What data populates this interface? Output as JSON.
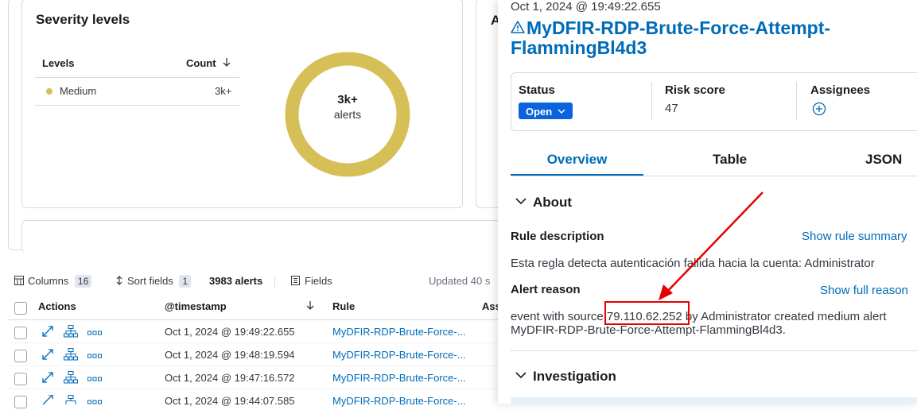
{
  "severity": {
    "title": "Severity levels",
    "col_levels": "Levels",
    "col_count": "Count",
    "rows": [
      {
        "level": "Medium",
        "count": "3k+",
        "color": "#d6bf57"
      }
    ],
    "donut_value": "3k+",
    "donut_label": "alerts",
    "donut_color": "#d6bf57"
  },
  "second_card_letter": "A",
  "toolbar": {
    "columns_label": "Columns",
    "columns_count": "16",
    "sort_label": "Sort fields",
    "sort_count": "1",
    "alerts_count": "3983 alerts",
    "fields_label": "Fields",
    "updated": "Updated 40 s"
  },
  "table": {
    "headers": {
      "actions": "Actions",
      "timestamp": "@timestamp",
      "rule": "Rule",
      "assignees": "Ass"
    },
    "rows": [
      {
        "timestamp": "Oct 1, 2024 @ 19:49:22.655",
        "rule": "MyDFIR-RDP-Brute-Force-..."
      },
      {
        "timestamp": "Oct 1, 2024 @ 19:48:19.594",
        "rule": "MyDFIR-RDP-Brute-Force-..."
      },
      {
        "timestamp": "Oct 1, 2024 @ 19:47:16.572",
        "rule": "MyDFIR-RDP-Brute-Force-..."
      },
      {
        "timestamp": "Oct 1, 2024 @ 19:44:07.585",
        "rule": "MyDFIR-RDP-Brute-Force-..."
      }
    ]
  },
  "flyout": {
    "date": "Oct 1, 2024 @ 19:49:22.655",
    "title": "MyDFIR-RDP-Brute-Force-Attempt-FlammingBl4d3",
    "status_label": "Status",
    "status_value": "Open",
    "risk_label": "Risk score",
    "risk_value": "47",
    "assignees_label": "Assignees",
    "tabs": [
      "Overview",
      "Table",
      "JSON"
    ],
    "about_title": "About",
    "rule_description_label": "Rule description",
    "show_rule_summary": "Show rule summary",
    "rule_description": "Esta regla detecta autenticación fallida hacia la cuenta: Administrator",
    "alert_reason_label": "Alert reason",
    "show_full_reason": "Show full reason",
    "reason_prefix": "event with source ",
    "reason_ip": "79.110.62.252",
    "reason_suffix": " by Administrator created medium alert",
    "reason_line2": "MyDFIR-RDP-Brute-Force-Attempt-FlammingBl4d3.",
    "investigation_title": "Investigation"
  }
}
